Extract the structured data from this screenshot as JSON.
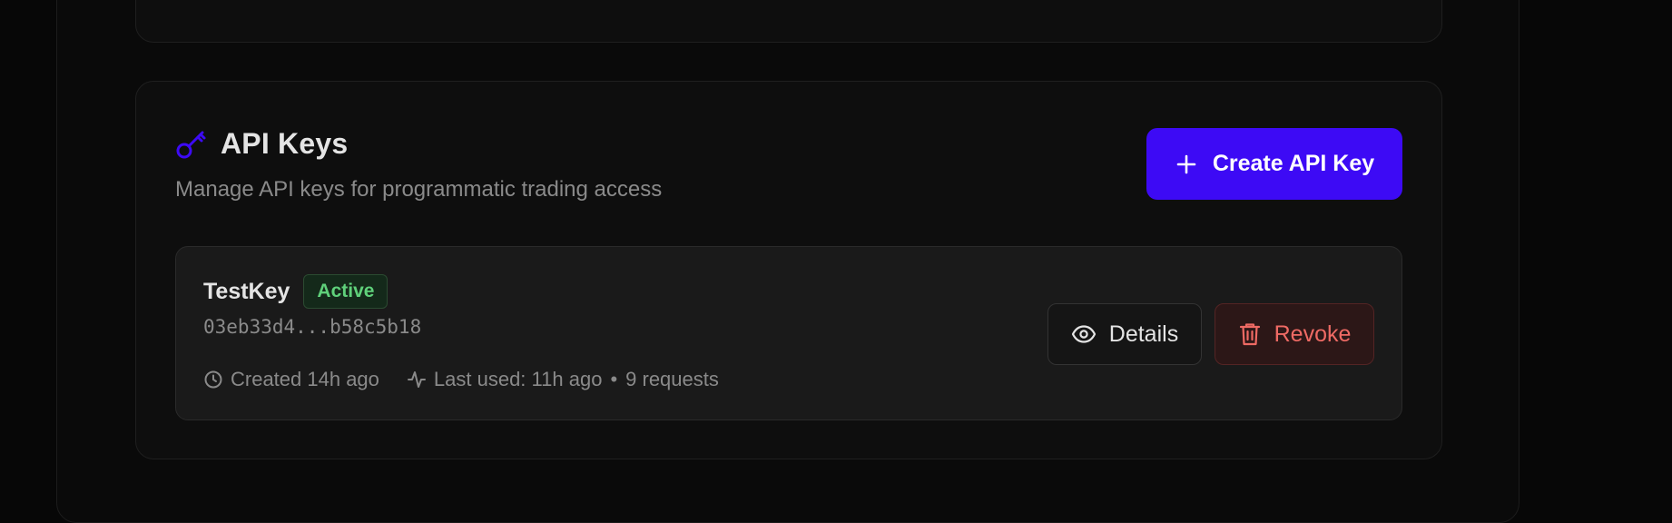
{
  "api_keys": {
    "title": "API Keys",
    "subtitle": "Manage API keys for programmatic trading access",
    "create_button_label": "Create API Key",
    "accent_color": "#3d0af5",
    "icons": {
      "section": "key-icon",
      "create": "plus-icon",
      "created": "clock-icon",
      "last_used": "activity-icon",
      "details": "eye-icon",
      "revoke": "trash-icon"
    },
    "keys": [
      {
        "name": "TestKey",
        "status": "Active",
        "status_color": "#5fd07a",
        "hash": "03eb33d4...b58c5b18",
        "created": "Created 14h ago",
        "last_used": "Last used: 11h ago",
        "separator": "•",
        "requests": "9 requests",
        "details_label": "Details",
        "revoke_label": "Revoke",
        "revoke_color": "#ee6a64"
      }
    ]
  }
}
